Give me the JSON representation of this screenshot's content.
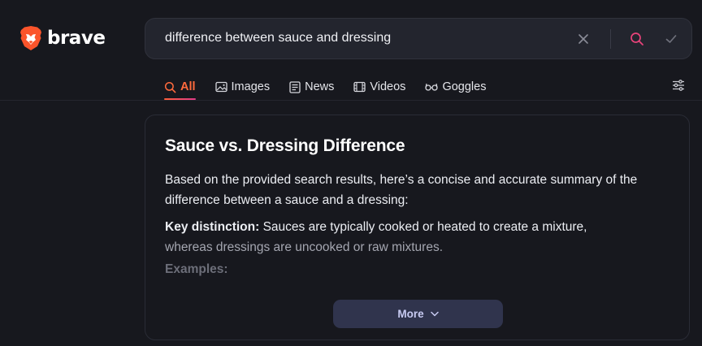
{
  "brand": {
    "name": "brave"
  },
  "search": {
    "query": "difference between sauce and dressing",
    "icons": [
      "close-icon",
      "search-icon",
      "check-icon"
    ]
  },
  "tabs": [
    {
      "label": "All",
      "icon": "search-icon",
      "active": true
    },
    {
      "label": "Images",
      "icon": "image-icon",
      "active": false
    },
    {
      "label": "News",
      "icon": "news-icon",
      "active": false
    },
    {
      "label": "Videos",
      "icon": "film-icon",
      "active": false
    },
    {
      "label": "Goggles",
      "icon": "goggles-icon",
      "active": false
    }
  ],
  "answer": {
    "title": "Sauce vs. Dressing Difference",
    "intro": "Based on the provided search results, here’s a concise and accurate summary of the difference between a sauce and a dressing:",
    "key_label": "Key distinction:",
    "key_text_a": " Sauces are typically cooked or heated to create a mixture,",
    "key_text_b": "whereas dressings are uncooked or raw mixtures.",
    "examples_label": "Examples:",
    "more_label": "More"
  },
  "colors": {
    "background": "#17181e",
    "accent": "#ff6a3d",
    "brand_orange": "#fb542b",
    "more_button": "#30344d"
  }
}
